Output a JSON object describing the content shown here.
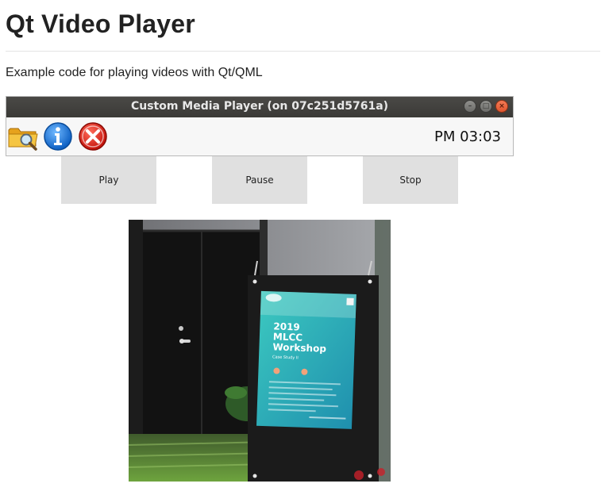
{
  "page": {
    "title": "Qt Video Player",
    "subtitle": "Example code for playing videos with Qt/QML"
  },
  "window": {
    "title": "Custom Media Player (on 07c251d5761a)",
    "clock": "PM 03:03",
    "toolbar_icons": [
      "folder-search-icon",
      "info-icon",
      "close-error-icon"
    ]
  },
  "controls": {
    "play_label": "Play",
    "pause_label": "Pause",
    "stop_label": "Stop"
  },
  "video": {
    "poster": {
      "year": "2019",
      "line1": "MLCC",
      "line2": "Workshop",
      "caption": "Case Study II"
    }
  },
  "colors": {
    "titlebar": "#3f3e3b",
    "button_bg": "#e0e0e0",
    "poster_teal": "#2bb6b0"
  }
}
